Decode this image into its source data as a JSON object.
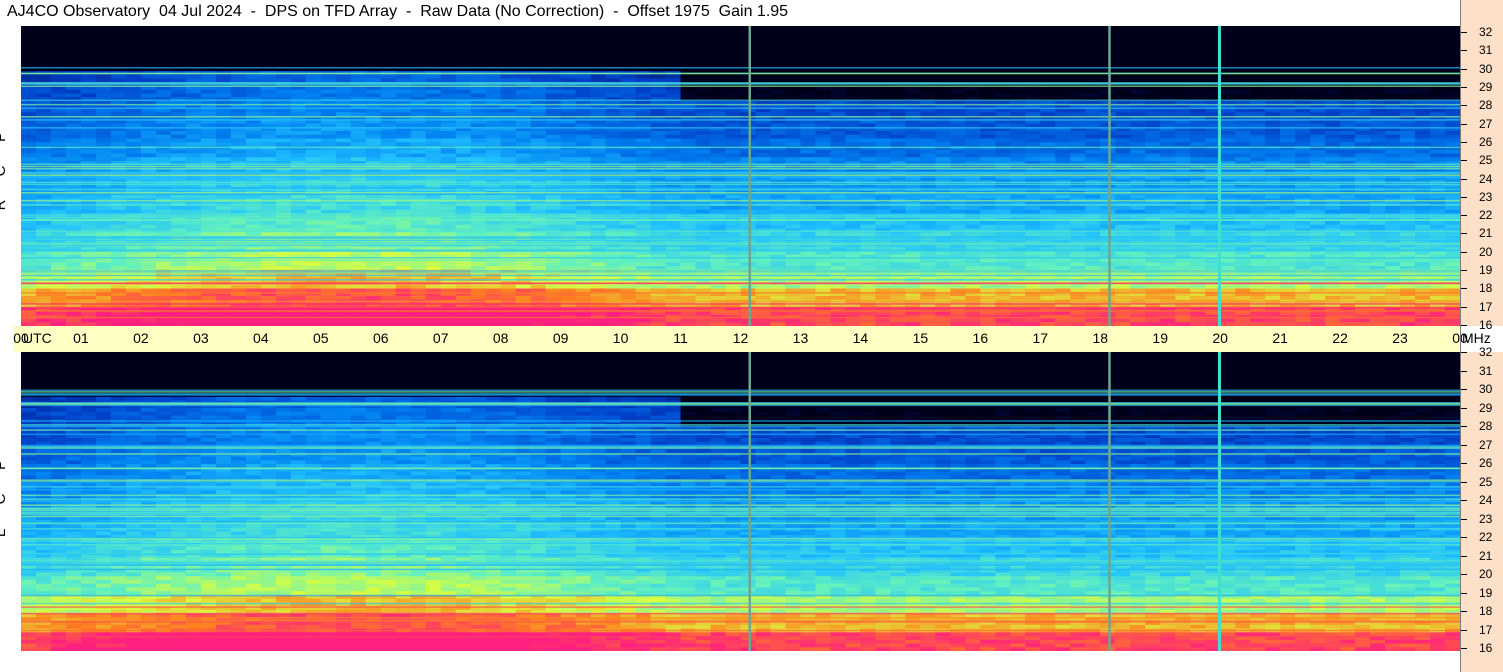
{
  "header": {
    "title": "AJ4CO Observatory  04 Jul 2024  -  DPS on TFD Array  -  Raw Data (No Correction)  -  Offset 1975  Gain 1.95"
  },
  "panels": {
    "top_label": [
      "R",
      "C",
      "P"
    ],
    "bottom_label": [
      "L",
      "C",
      "P"
    ]
  },
  "axes": {
    "utc_unit": "UTC",
    "mhz_unit": "MHz",
    "time_ticks": [
      "00",
      "01",
      "02",
      "03",
      "04",
      "05",
      "06",
      "07",
      "08",
      "09",
      "10",
      "11",
      "12",
      "13",
      "14",
      "15",
      "16",
      "17",
      "18",
      "19",
      "20",
      "21",
      "22",
      "23",
      "00"
    ],
    "freq_ticks": [
      "32",
      "31",
      "30",
      "29",
      "28",
      "27",
      "26",
      "25",
      "24",
      "23",
      "22",
      "21",
      "20",
      "19",
      "18",
      "17",
      "16"
    ]
  },
  "chart_data": {
    "type": "heatmap",
    "title": "AJ4CO Observatory  04 Jul 2024  -  DPS on TFD Array  -  Raw Data (No Correction)  -  Offset 1975  Gain 1.95",
    "xlabel": "UTC",
    "ylabel": "MHz",
    "x_range": [
      0,
      24
    ],
    "y_range": [
      16,
      32
    ],
    "series": [
      {
        "name": "RCP",
        "band_levels": [
          0.95,
          0.82,
          0.7,
          0.6,
          0.55,
          0.5,
          0.45,
          0.42,
          0.38,
          0.34,
          0.3,
          0.27,
          0.24,
          0.2,
          0.17,
          0.14
        ]
      },
      {
        "name": "LCP",
        "band_levels": [
          0.95,
          0.82,
          0.7,
          0.6,
          0.55,
          0.5,
          0.45,
          0.42,
          0.38,
          0.34,
          0.3,
          0.27,
          0.24,
          0.2,
          0.17,
          0.14
        ]
      }
    ],
    "vertical_markers_utc": [
      12.15,
      18.15,
      19.98
    ],
    "colormap": [
      "#00001a",
      "#001a7a",
      "#0040c8",
      "#0080f0",
      "#20c0ff",
      "#60f0c0",
      "#d8ff40",
      "#ff8020",
      "#ff2080"
    ]
  }
}
